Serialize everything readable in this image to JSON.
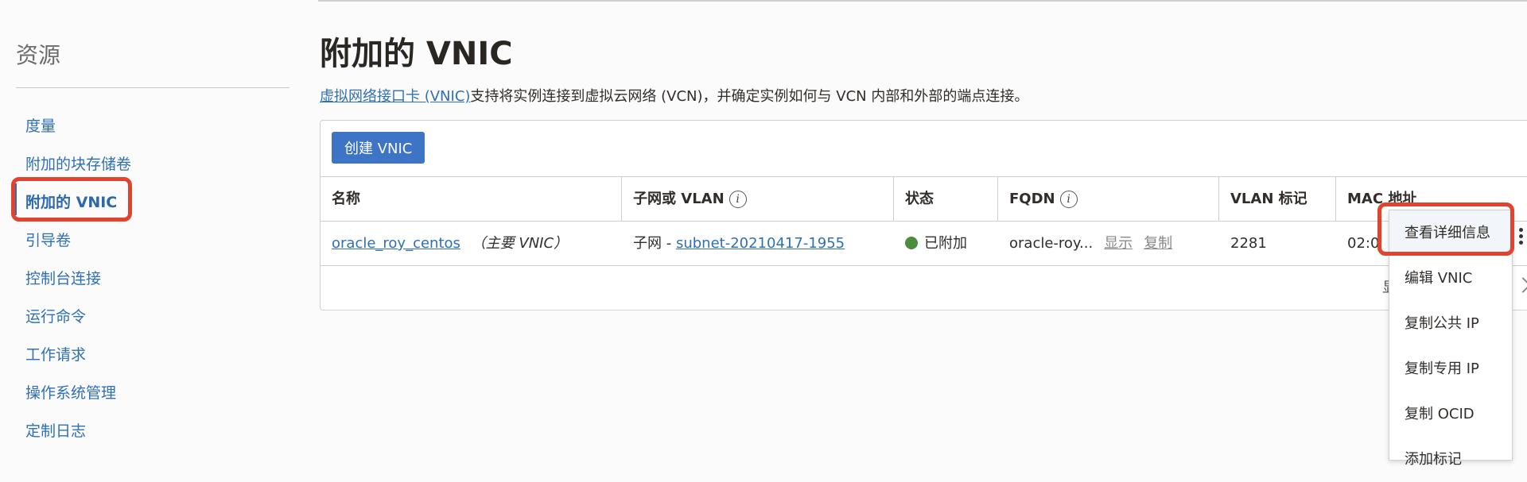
{
  "sidebar": {
    "title": "资源",
    "items": [
      {
        "label": "度量"
      },
      {
        "label": "附加的块存储卷"
      },
      {
        "label": "附加的 VNIC"
      },
      {
        "label": "引导卷"
      },
      {
        "label": "控制台连接"
      },
      {
        "label": "运行命令"
      },
      {
        "label": "工作请求"
      },
      {
        "label": "操作系统管理"
      },
      {
        "label": "定制日志"
      }
    ]
  },
  "main": {
    "title": "附加的 VNIC",
    "desc_link": "虚拟网络接口卡 (VNIC)",
    "desc_text": "支持将实例连接到虚拟云网络 (VCN)，并确定实例如何与 VCN 内部和外部的端点连接。",
    "create_button": "创建 VNIC"
  },
  "table": {
    "headers": [
      "名称",
      "子网或 VLAN",
      "状态",
      "FQDN",
      "VLAN 标记",
      "MAC 地址"
    ],
    "row": {
      "name_link": "oracle_roy_centos",
      "name_note": "（主要 VNIC）",
      "subnet_prefix": "子网 - ",
      "subnet_link": "subnet-20210417-1955",
      "status": "已附加",
      "fqdn": "oracle-roy...",
      "fqdn_show": "显示",
      "fqdn_copy": "复制",
      "vlan_tag": "2281",
      "mac": "02:0"
    },
    "footer_fragment": "显"
  },
  "action_menu": {
    "items": [
      {
        "label": "查看详细信息"
      },
      {
        "label": "编辑 VNIC"
      },
      {
        "label": "复制公共 IP"
      },
      {
        "label": "复制专用 IP"
      },
      {
        "label": "复制 OCID"
      },
      {
        "label": "添加标记"
      }
    ]
  },
  "colors": {
    "accent": "#2f6fb5",
    "button": "#3e74c6",
    "highlight": "#e0442f",
    "status_ok": "#4a8d3c"
  }
}
